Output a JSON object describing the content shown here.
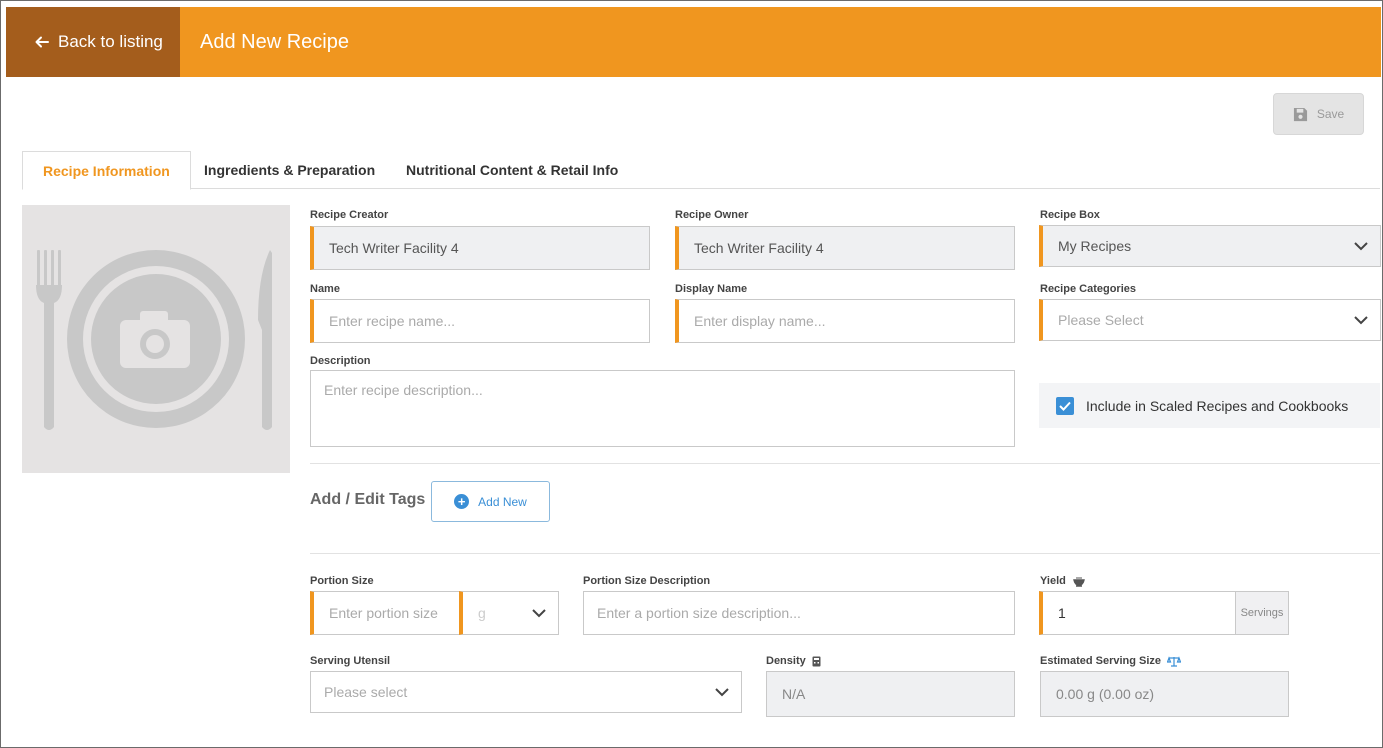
{
  "header": {
    "back_label": "Back to listing",
    "title": "Add New Recipe",
    "bg_color": "#f0961f",
    "back_bg_color": "#a45d1c"
  },
  "toolbar": {
    "save_label": "Save"
  },
  "tabs": [
    {
      "label": "Recipe Information",
      "active": true
    },
    {
      "label": "Ingredients & Preparation",
      "active": false
    },
    {
      "label": "Nutritional Content & Retail Info",
      "active": false
    }
  ],
  "form": {
    "recipe_creator": {
      "label": "Recipe Creator",
      "value": "Tech Writer Facility 4"
    },
    "recipe_owner": {
      "label": "Recipe Owner",
      "value": "Tech Writer Facility 4"
    },
    "recipe_box": {
      "label": "Recipe Box",
      "value": "My Recipes"
    },
    "name": {
      "label": "Name",
      "placeholder": "Enter recipe name..."
    },
    "display_name": {
      "label": "Display Name",
      "placeholder": "Enter display name..."
    },
    "recipe_categories": {
      "label": "Recipe Categories",
      "placeholder": "Please Select"
    },
    "description": {
      "label": "Description",
      "placeholder": "Enter recipe description..."
    },
    "include_scaled": {
      "label": "Include in Scaled Recipes and Cookbooks",
      "checked": true
    },
    "tags": {
      "label": "Add / Edit Tags",
      "add_label": "Add New"
    },
    "portion_size": {
      "label": "Portion Size",
      "placeholder": "Enter portion size",
      "unit": "g"
    },
    "portion_size_description": {
      "label": "Portion Size Description",
      "placeholder": "Enter a portion size description..."
    },
    "yield": {
      "label": "Yield",
      "value": "1",
      "suffix": "Servings"
    },
    "serving_utensil": {
      "label": "Serving Utensil",
      "placeholder": "Please select"
    },
    "density": {
      "label": "Density",
      "value": "N/A"
    },
    "estimated_serving_size": {
      "label": "Estimated Serving Size",
      "value": "0.00 g (0.00 oz)"
    }
  },
  "colors": {
    "accent": "#f0961f",
    "link": "#3a8fd6"
  }
}
